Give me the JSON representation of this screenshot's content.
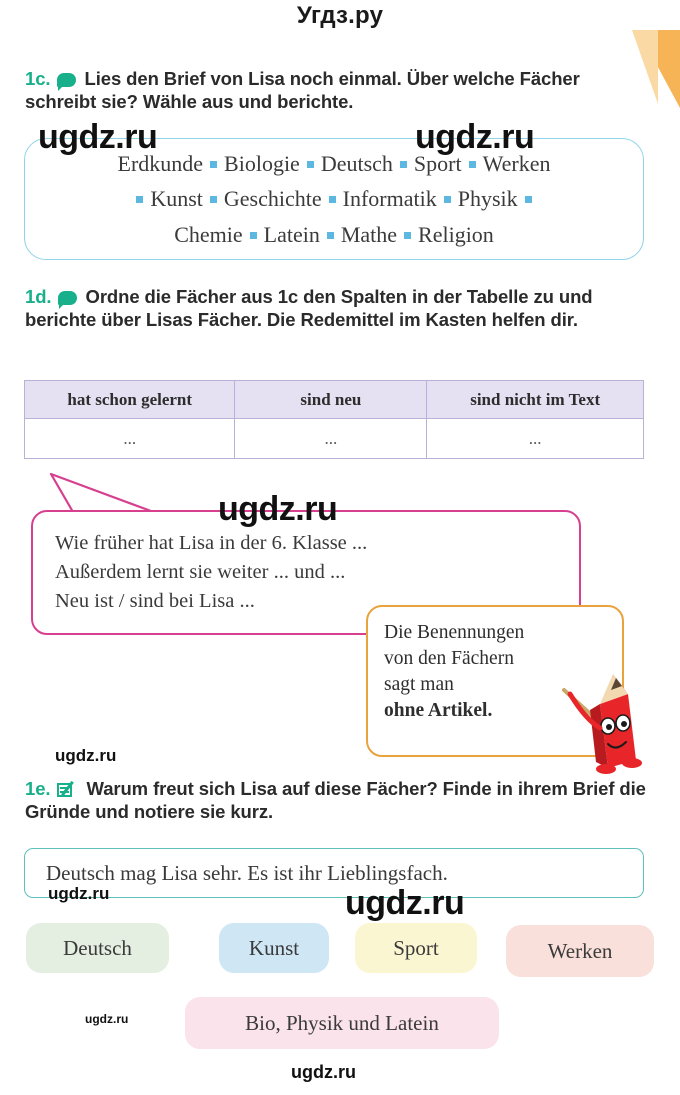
{
  "site": {
    "header_title": "Угдз.ру",
    "watermark_text": "ugdz.ru"
  },
  "tasks": {
    "c": {
      "number": "1c.",
      "icon": "speech-bubble-icon",
      "text": "Lies den Brief von Lisa noch einmal. Über welche Fächer schreibt sie? Wähle aus und berichte."
    },
    "d": {
      "number": "1d.",
      "icon": "speech-bubble-icon",
      "text": "Ordne die Fächer aus 1c den Spalten in der Tabelle zu und berichte über Lisas Fächer. Die Redemittel im Kasten helfen dir."
    },
    "e": {
      "number": "1e.",
      "icon": "write-note-icon",
      "text": "Warum freut sich Lisa auf diese Fächer? Finde in ihrem Brief die Gründe und notiere sie kurz."
    }
  },
  "subjects_box": {
    "accent_color": "#8fd3e8",
    "bullet_color": "#5cb8e0",
    "lines": [
      [
        "Erdkunde",
        "Biologie",
        "Deutsch",
        "Sport",
        "Werken"
      ],
      [
        "Kunst",
        "Geschichte",
        "Informatik",
        "Physik"
      ],
      [
        "Chemie",
        "Latein",
        "Mathe",
        "Religion"
      ]
    ]
  },
  "table": {
    "header_bg": "#e5e1f3",
    "border_color": "#b8b3d6",
    "headers": [
      "hat schon gelernt",
      "sind neu",
      "sind nicht im Text"
    ],
    "rows": [
      [
        "...",
        "...",
        "..."
      ]
    ]
  },
  "speech_bubble": {
    "border_color": "#d6408f",
    "lines": [
      "Wie früher hat Lisa in der 6. Klasse ...",
      "Außerdem lernt sie weiter ... und ...",
      "Neu ist / sind bei Lisa ..."
    ]
  },
  "grammar_box": {
    "border_color": "#e8a33d",
    "lines": [
      "Die Benennungen",
      "von den Fächern",
      "sagt man"
    ],
    "bold_line": "ohne Artikel.",
    "mascot": "pencil-mascot-icon"
  },
  "answer_box": {
    "border_color": "#5fc0bb",
    "text": "Deutsch mag Lisa sehr. Es ist ihr Lieblingsfach."
  },
  "pills": [
    {
      "label": "Deutsch",
      "color": "#e4efe2"
    },
    {
      "label": "Kunst",
      "color": "#cfe6f5"
    },
    {
      "label": "Sport",
      "color": "#fbf6d2"
    },
    {
      "label": "Werken",
      "color": "#fae0da"
    },
    {
      "label": "Bio, Physik und Latein",
      "color": "#fbe3ec"
    }
  ]
}
